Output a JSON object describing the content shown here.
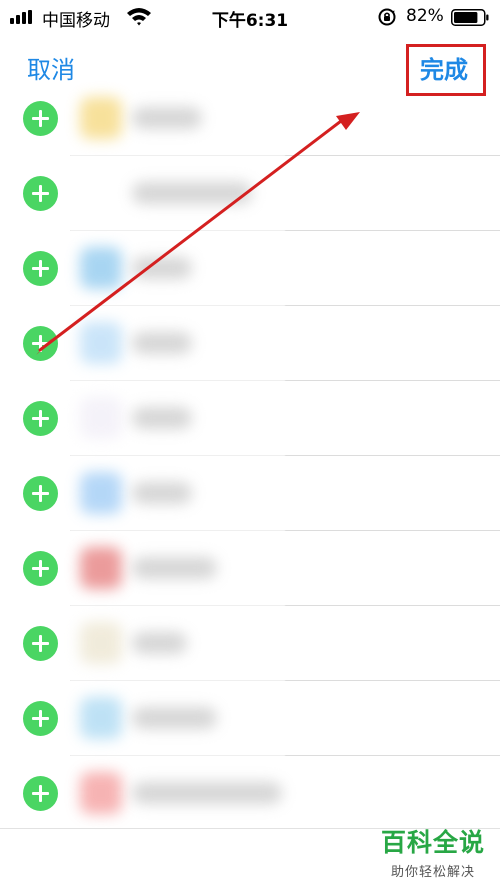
{
  "status_bar": {
    "carrier": "中国移动",
    "time": "下午6:31",
    "battery_percent": "82%",
    "battery_level": 0.82,
    "icons": [
      "signal-icon",
      "wifi-icon",
      "orientation-lock-icon",
      "battery-icon"
    ]
  },
  "nav": {
    "cancel_label": "取消",
    "done_label": "完成"
  },
  "list": {
    "rows": [
      {
        "action": "add"
      },
      {
        "action": "add"
      },
      {
        "action": "add"
      },
      {
        "action": "add"
      },
      {
        "action": "add"
      },
      {
        "action": "add"
      },
      {
        "action": "add"
      },
      {
        "action": "add"
      },
      {
        "action": "add"
      },
      {
        "action": "add"
      }
    ],
    "icon_colors": [
      "#f5d77a",
      "#ffffff",
      "#8cc8ee",
      "#b9dcf7",
      "#f1eef7",
      "#9ccaf5",
      "#e57a7a",
      "#ece5cf",
      "#a9d8f2",
      "#f49a9a"
    ]
  },
  "annotation": {
    "type": "arrow",
    "color": "#d42020",
    "points_to": "done-button"
  },
  "watermark": {
    "title": "百科全说",
    "subtitle": "助你轻松解决"
  },
  "colors": {
    "accent": "#1e88e5",
    "add_green": "#4ad563",
    "highlight_red": "#d42020"
  }
}
